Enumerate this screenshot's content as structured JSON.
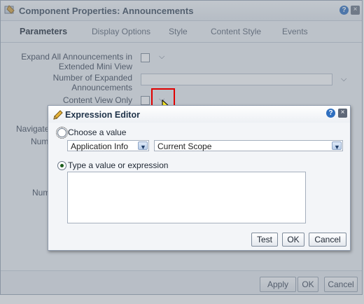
{
  "bg_dialog": {
    "title": "Component Properties: Announcements",
    "help_icon": "?",
    "close_icon": "×",
    "tabs": [
      {
        "label": "Parameters",
        "active": true
      },
      {
        "label": "Display Options"
      },
      {
        "label": "Style"
      },
      {
        "label": "Content Style"
      },
      {
        "label": "Events"
      }
    ],
    "fields": {
      "expand_all_line1": "Expand All Announcements in",
      "expand_all_line2": "Extended Mini View",
      "num_expanded_line1": "Number of Expanded",
      "num_expanded_line2": "Announcements",
      "content_view_only": "Content View Only",
      "navigate_partial": "Navigate",
      "numb_partial": "Numb",
      "num_partial": "Num"
    },
    "footer": {
      "apply": "Apply",
      "ok": "OK",
      "cancel": "Cancel"
    }
  },
  "expression_editor": {
    "title": "Expression Editor",
    "help_icon": "?",
    "close_icon": "×",
    "choose_value_label": "Choose a value",
    "type_value_label": "Type a value or expression",
    "selected_option": "type",
    "select_category": {
      "value": "Application Info"
    },
    "select_scope": {
      "value": "Current Scope"
    },
    "expression_value": "",
    "buttons": {
      "test": "Test",
      "ok": "OK",
      "cancel": "Cancel"
    }
  },
  "colors": {
    "highlight": "#e00000",
    "accent_blue": "#2f6fbf",
    "title_text": "#1f3349"
  }
}
